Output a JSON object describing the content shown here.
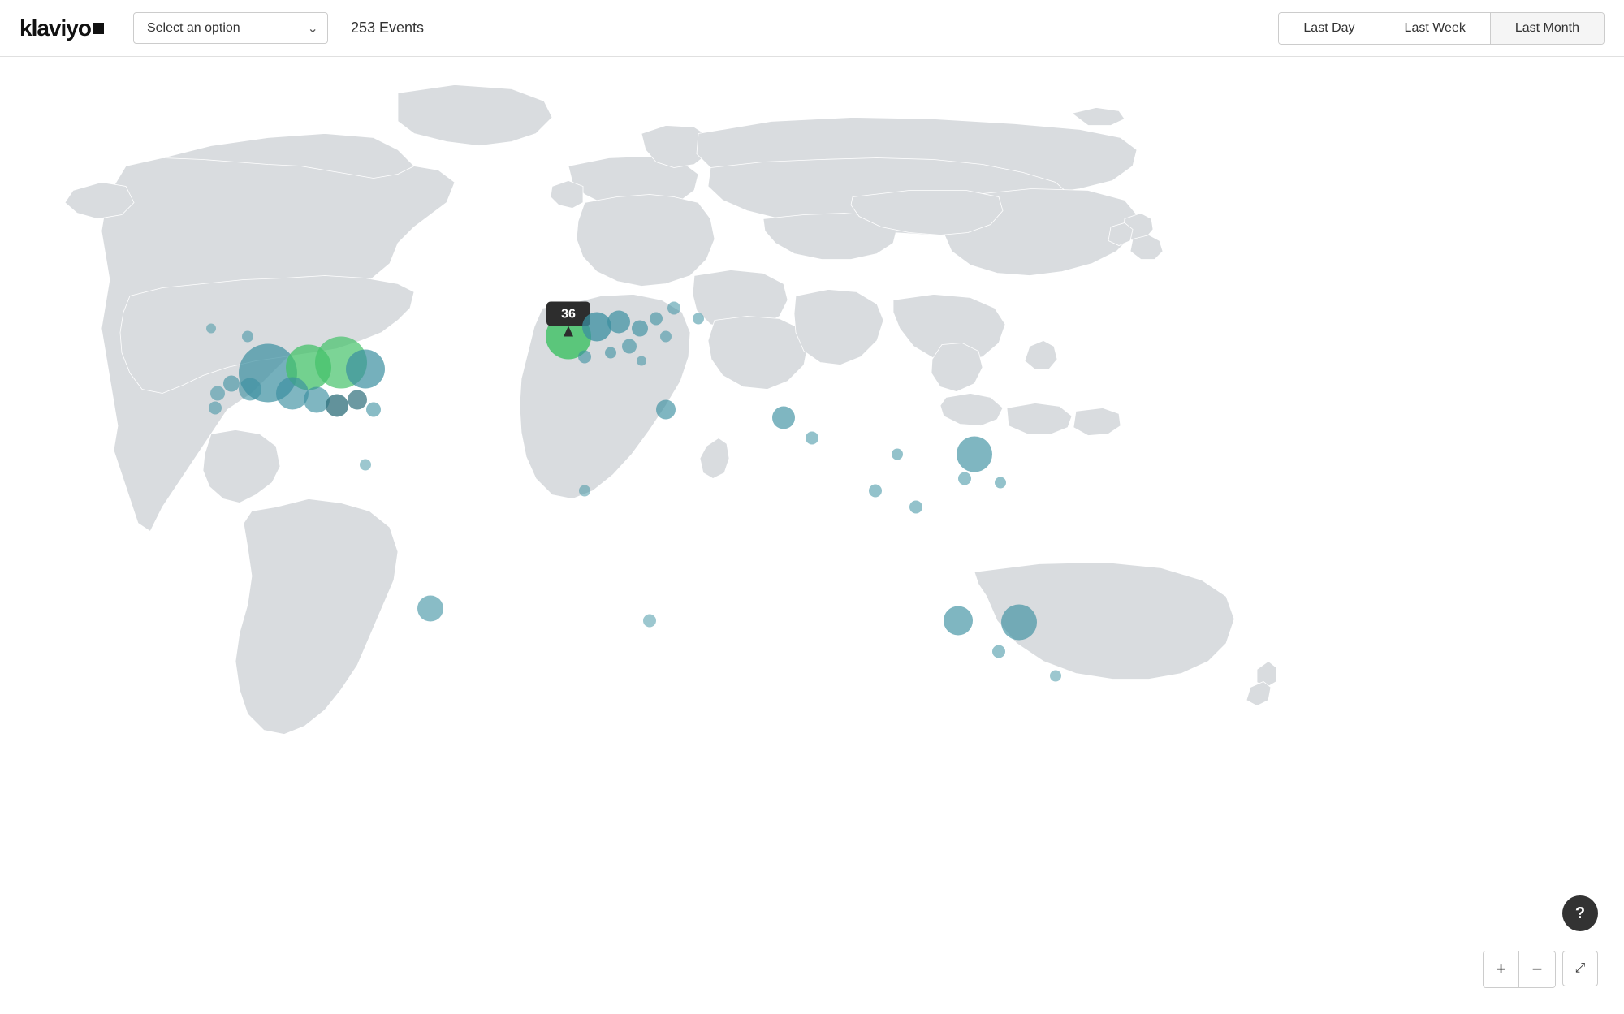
{
  "header": {
    "logo_text": "klaviyo",
    "select_placeholder": "Select an option",
    "events_count": "253 Events",
    "time_buttons": [
      {
        "label": "Last Day",
        "active": false
      },
      {
        "label": "Last Week",
        "active": false
      },
      {
        "label": "Last Month",
        "active": true
      }
    ]
  },
  "map": {
    "tooltip_value": "36",
    "colors": {
      "land": "#d9dcdf",
      "bubble_teal": "#3a8fa0",
      "bubble_green": "#44c26a",
      "bubble_dark": "#2e6d7a",
      "tooltip_bg": "#2d2d2d"
    }
  },
  "controls": {
    "help_label": "?",
    "zoom_in_label": "+",
    "zoom_out_label": "−",
    "expand_label": "⤢"
  }
}
